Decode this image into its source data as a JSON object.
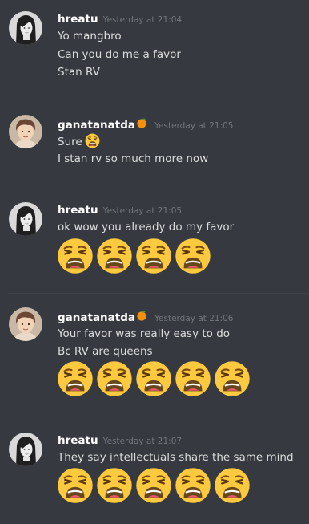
{
  "colors": {
    "background": "#36393f",
    "username": "#ffffff",
    "timestamp": "#72767d",
    "message_text": "#dcddde",
    "emoji_face": "#fdc93f"
  },
  "messages": [
    {
      "username": "hreatu",
      "timestamp": "Yesterday at 21:04",
      "avatar": "girl-avatar",
      "lines": [
        "Yo mangbro",
        "Can you do me a favor",
        "Stan RV"
      ],
      "emoji_count": 0
    },
    {
      "username": "ganatanatda",
      "badge_icon": "tangerine-icon",
      "timestamp": "Yesterday at 21:05",
      "avatar": "boy-avatar",
      "lines": [
        "Sure",
        "I stan rv so much more now"
      ],
      "inline_emoji": "weary-face-icon",
      "emoji_count": 0
    },
    {
      "username": "hreatu",
      "timestamp": "Yesterday at 21:05",
      "avatar": "girl-avatar",
      "lines": [
        "ok wow you already do my favor"
      ],
      "emoji": "weary-face-icon",
      "emoji_count": 4
    },
    {
      "username": "ganatanatda",
      "badge_icon": "tangerine-icon",
      "timestamp": "Yesterday at 21:06",
      "avatar": "boy-avatar",
      "lines": [
        "Your favor was really easy to do",
        "Bc RV are queens"
      ],
      "emoji": "weary-face-icon",
      "emoji_count": 5
    },
    {
      "username": "hreatu",
      "timestamp": "Yesterday at 21:07",
      "avatar": "girl-avatar",
      "lines": [
        "They say intellectuals share the same mind"
      ],
      "emoji": "weary-face-icon",
      "emoji_count": 5
    }
  ]
}
